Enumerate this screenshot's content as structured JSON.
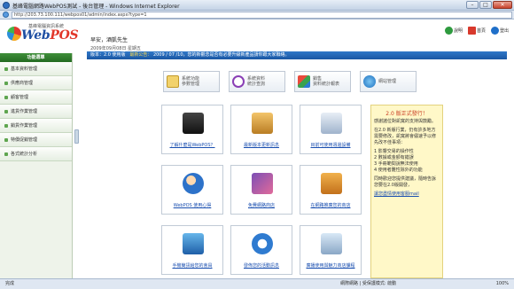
{
  "window": {
    "title": "基峰電腦網路WebPOS測試 - 後台管理 - Windows Internet Explorer",
    "url": "http://203.73.100.111/webpos01/admin/index.aspx?type=1",
    "min": "–",
    "max": "□",
    "close": "✕"
  },
  "header": {
    "company": "基峰電腦資訊系統",
    "brand_web": "Web",
    "brand_pos": "POS",
    "greeting": "早安，酒凱先生",
    "date": "2009年09月08日 星期五",
    "links": [
      {
        "label": "說明",
        "icon": "help-icon"
      },
      {
        "label": "首頁",
        "icon": "home-icon"
      },
      {
        "label": "登出",
        "icon": "logout-icon"
      }
    ]
  },
  "sidebar": {
    "title": "功能選單",
    "items": [
      {
        "label": "基本資料管理"
      },
      {
        "label": "供應商管理"
      },
      {
        "label": "顧客管理"
      },
      {
        "label": "進貨作業管理"
      },
      {
        "label": "銷貨作業管理"
      },
      {
        "label": "特價促銷管理"
      },
      {
        "label": "各式統計分析"
      }
    ]
  },
  "version_bar": {
    "version": "版本：2.0 使用版",
    "news_label": "最新公告：",
    "news": "2009 / 07 /10，您的新觀念是否有必要升級新產品請你跟大家聯絡。"
  },
  "shortcuts": [
    {
      "label": "系統功能\n參數管理",
      "icon": "document-icon"
    },
    {
      "label": "系統資料\n統計查詢",
      "icon": "magnifier-icon"
    },
    {
      "label": "銷售\n資料統計報表",
      "icon": "chart-icon"
    },
    {
      "label": "網站管理",
      "icon": "globe-icon"
    }
  ],
  "tiles": [
    {
      "caption": "了解什麼是WebPOS？",
      "icon": "pos-terminal-icon"
    },
    {
      "caption": "最新版本更新訊息",
      "icon": "download-box-icon"
    },
    {
      "caption": "目前可使用週邊設備",
      "icon": "peripheral-icon"
    },
    {
      "caption": "WebPOS 使用心得",
      "icon": "user-icon"
    },
    {
      "caption": "免費網路商店",
      "icon": "store-icon"
    },
    {
      "caption": "在網路推廣您的商店",
      "icon": "promote-icon"
    },
    {
      "caption": "手機簡訊給您的會員",
      "icon": "mobile-icon"
    },
    {
      "caption": "發佈您的活動訊息",
      "icon": "email-icon"
    },
    {
      "caption": "廣播使用與魅力商店課程",
      "icon": "course-icon"
    }
  ],
  "notice": {
    "title": "2.0 版正式發行！",
    "paragraphs": [
      "感謝諸位對凱寬的支持與鼓勵。",
      "在2.0 新版行業，仍有許多地方需要修改，凱寬將會儘速予以修先改不佳事項：",
      "1 影響交易的操作性\n2 數據或金額有錯誤\n3 手冊範間說無法使用\n4 使用者難性除外的功能",
      "同時歡迎您提供建議，隨時告訴您要在2.0版開發，"
    ],
    "link": "讓您盡情使用客服mail"
  },
  "status": {
    "left": "完成",
    "zone": "網際網路 | 受保護模式: 啟動",
    "zoom": "100%"
  }
}
